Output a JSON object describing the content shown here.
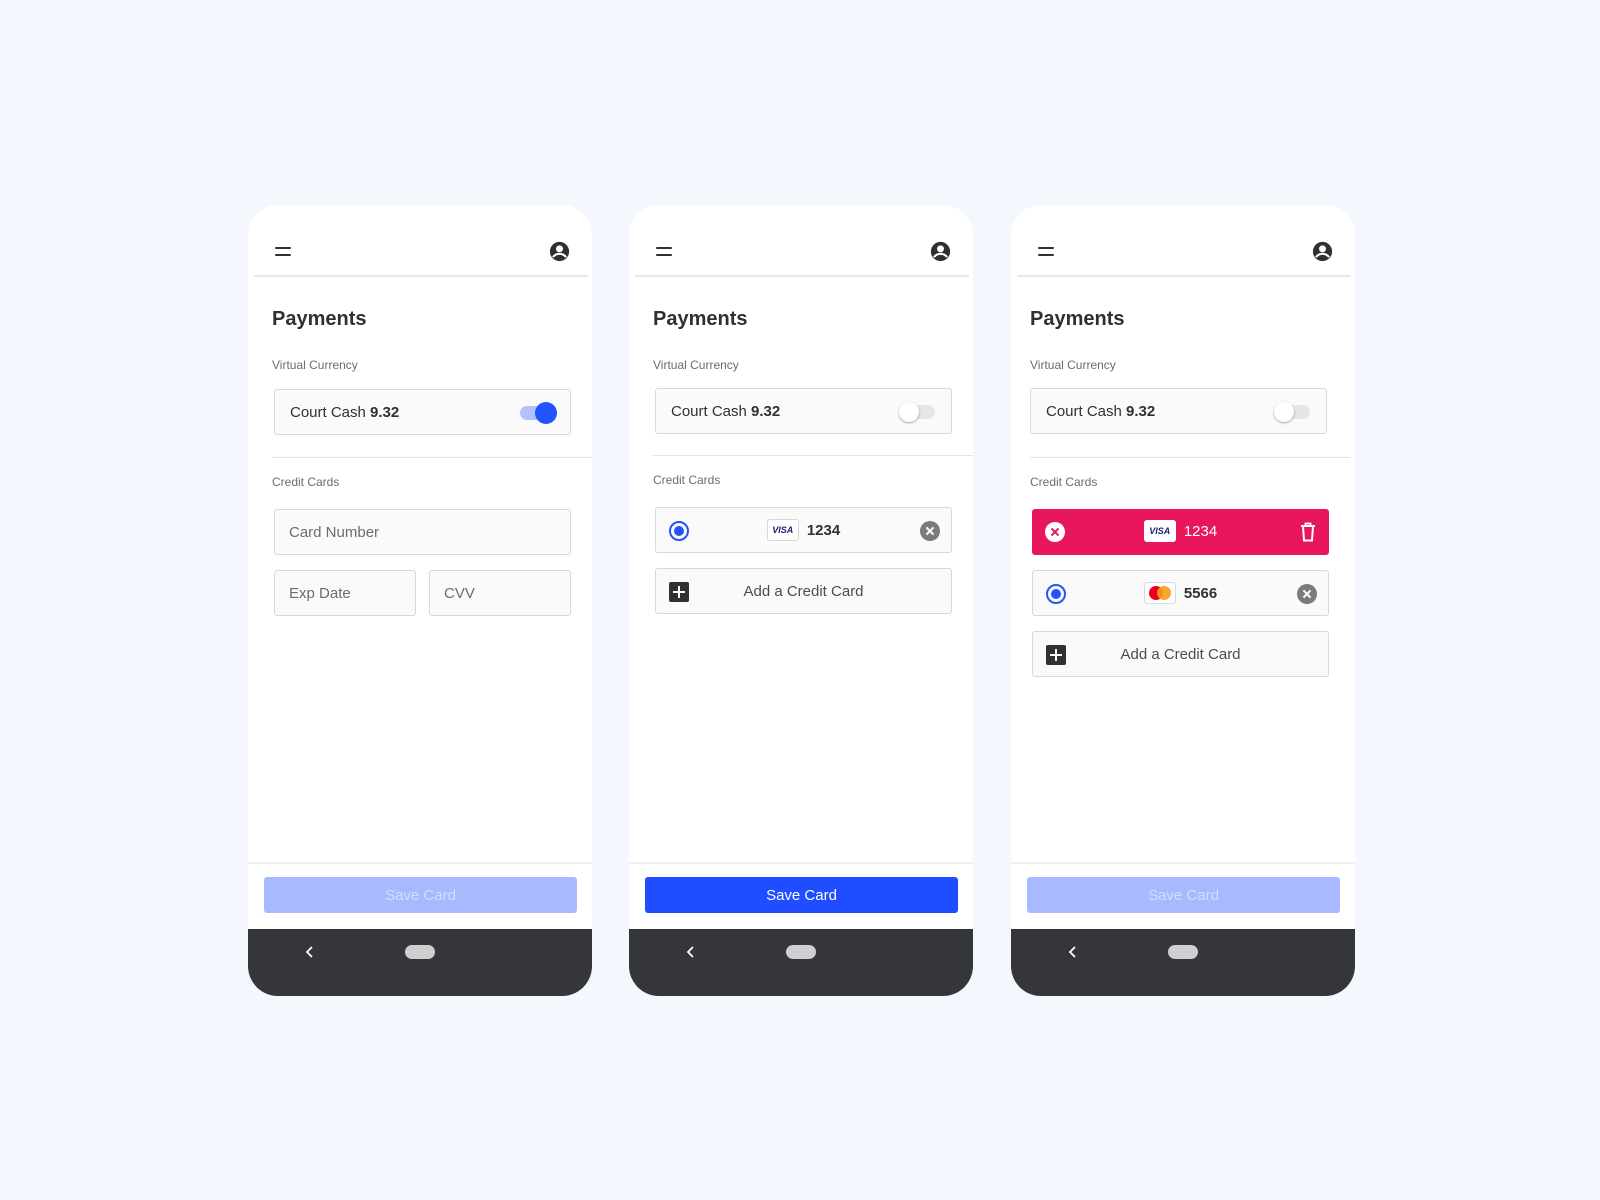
{
  "colors": {
    "background": "#f4f7fd",
    "accent": "#2352ff",
    "save_disabled": "#a8b9ff",
    "delete_red": "#e8175d",
    "nav_bar": "#35363a"
  },
  "screens": [
    {
      "title": "Payments",
      "virtual_currency_label": "Virtual Currency",
      "currency_name": "Court Cash",
      "currency_amount": "9.32",
      "currency_toggle": "on",
      "credit_cards_label": "Credit Cards",
      "card_number_placeholder": "Card Number",
      "exp_date_placeholder": "Exp Date",
      "cvv_placeholder": "CVV",
      "save_label": "Save Card",
      "save_state": "disabled"
    },
    {
      "title": "Payments",
      "virtual_currency_label": "Virtual Currency",
      "currency_name": "Court Cash",
      "currency_amount": "9.32",
      "currency_toggle": "off",
      "credit_cards_label": "Credit Cards",
      "cards": [
        {
          "brand": "VISA",
          "last4": "1234",
          "selected": true
        }
      ],
      "add_card_label": "Add a Credit Card",
      "save_label": "Save Card",
      "save_state": "active"
    },
    {
      "title": "Payments",
      "virtual_currency_label": "Virtual Currency",
      "currency_name": "Court Cash",
      "currency_amount": "9.32",
      "currency_toggle": "off",
      "credit_cards_label": "Credit Cards",
      "swiped_card": {
        "brand": "VISA",
        "last4": "1234"
      },
      "cards": [
        {
          "brand": "mastercard",
          "last4": "5566",
          "selected": true
        }
      ],
      "add_card_label": "Add a Credit Card",
      "save_label": "Save Card",
      "save_state": "disabled"
    }
  ],
  "icons": {
    "menu": "hamburger-menu-icon",
    "account": "account-circle-icon",
    "back": "chevron-left-icon",
    "home": "home-pill-icon",
    "clear": "close-circle-icon",
    "add": "plus-box-icon",
    "delete": "trash-icon"
  }
}
